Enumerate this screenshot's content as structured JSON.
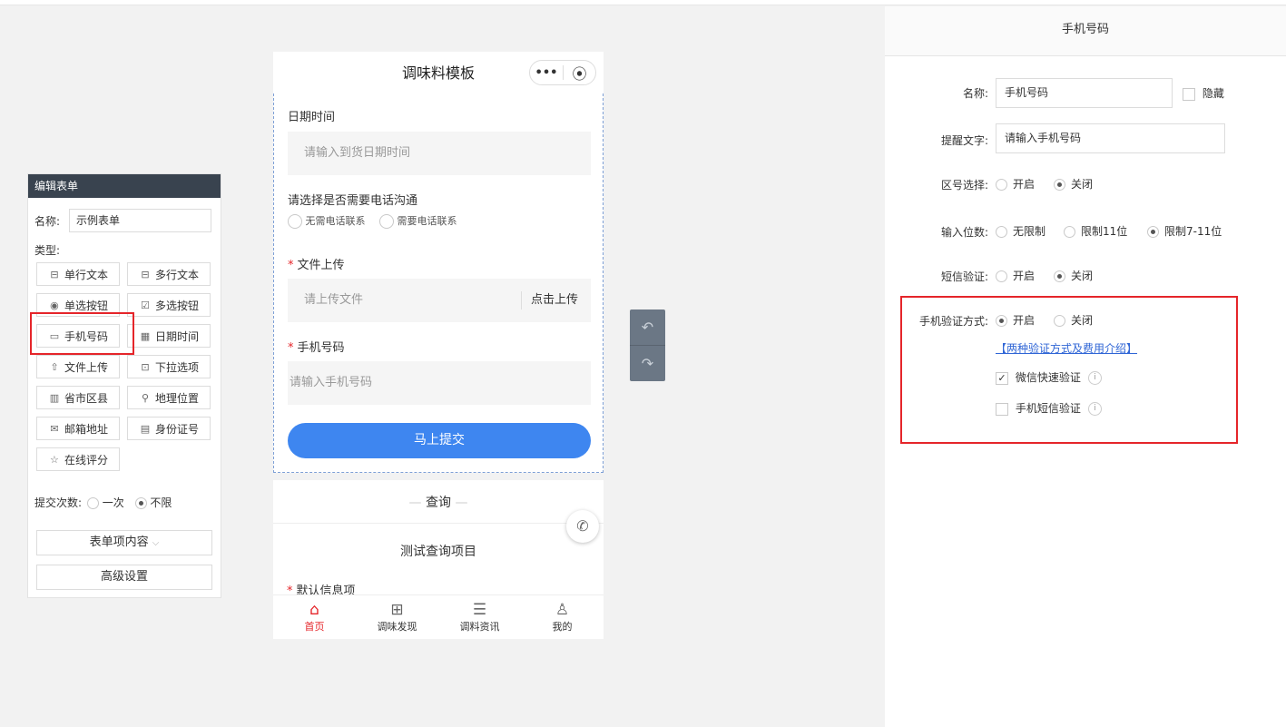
{
  "left_panel": {
    "title": "编辑表单",
    "name_label": "名称:",
    "name_value": "示例表单",
    "type_label": "类型:",
    "types": [
      {
        "label": "单行文本",
        "icon": "single-line-icon",
        "glyph": "⊟"
      },
      {
        "label": "多行文本",
        "icon": "multi-line-icon",
        "glyph": "⊟"
      },
      {
        "label": "单选按钮",
        "icon": "radio-icon",
        "glyph": "◉"
      },
      {
        "label": "多选按钮",
        "icon": "checkbox-icon",
        "glyph": "☑"
      },
      {
        "label": "手机号码",
        "icon": "phone-icon",
        "glyph": "▭"
      },
      {
        "label": "日期时间",
        "icon": "calendar-icon",
        "glyph": "▦"
      },
      {
        "label": "文件上传",
        "icon": "upload-icon",
        "glyph": "⇧"
      },
      {
        "label": "下拉选项",
        "icon": "dropdown-icon",
        "glyph": "⊡"
      },
      {
        "label": "省市区县",
        "icon": "building-icon",
        "glyph": "▥"
      },
      {
        "label": "地理位置",
        "icon": "location-icon",
        "glyph": "⚲"
      },
      {
        "label": "邮箱地址",
        "icon": "mail-icon",
        "glyph": "✉"
      },
      {
        "label": "身份证号",
        "icon": "id-card-icon",
        "glyph": "▤"
      },
      {
        "label": "在线评分",
        "icon": "star-icon",
        "glyph": "☆"
      }
    ],
    "submit_times_label": "提交次数:",
    "submit_once": "一次",
    "submit_unlimited": "不限",
    "form_content_button": "表单项内容",
    "advanced_button": "高级设置"
  },
  "phone": {
    "title": "调味料模板",
    "capsule_dots": "•••",
    "capsule_target": "⦿",
    "fields": {
      "date_label": "日期时间",
      "date_placeholder": "请输入到货日期时间",
      "contact_label": "请选择是否需要电话沟通",
      "contact_opt1": "无需电话联系",
      "contact_opt2": "需要电话联系",
      "file_label": "文件上传",
      "file_placeholder": "请上传文件",
      "file_button": "点击上传",
      "phone_label": "手机号码",
      "phone_placeholder": "请输入手机号码"
    },
    "required_mark": "*",
    "submit": "马上提交",
    "query_title": "查询",
    "query_item": "测试查询项目",
    "default_info": "默认信息项",
    "tabs": [
      {
        "label": "首页",
        "glyph": "⌂",
        "icon": "home-icon"
      },
      {
        "label": "调味发现",
        "glyph": "⊞",
        "icon": "grid-icon"
      },
      {
        "label": "调料资讯",
        "glyph": "☰",
        "icon": "document-icon"
      },
      {
        "label": "我的",
        "glyph": "♙",
        "icon": "user-icon"
      }
    ]
  },
  "right_panel": {
    "title": "手机号码",
    "name_label": "名称:",
    "name_value": "手机号码",
    "hide_label": "隐藏",
    "hint_label": "提醒文字:",
    "hint_value": "请输入手机号码",
    "area_label": "区号选择:",
    "area_on": "开启",
    "area_off": "关闭",
    "digits_label": "输入位数:",
    "digits_opt1": "无限制",
    "digits_opt2": "限制11位",
    "digits_opt3": "限制7-11位",
    "sms_label": "短信验证:",
    "sms_on": "开启",
    "sms_off": "关闭",
    "verify_label": "手机验证方式:",
    "verify_on": "开启",
    "verify_off": "关闭",
    "verify_link": "【两种验证方式及费用介绍】",
    "wechat_verify": "微信快速验证",
    "sms_verify": "手机短信验证",
    "info_glyph": "i"
  },
  "colors": {
    "accent": "#3e86f0",
    "highlight": "#e5252a",
    "header": "#39434f"
  }
}
